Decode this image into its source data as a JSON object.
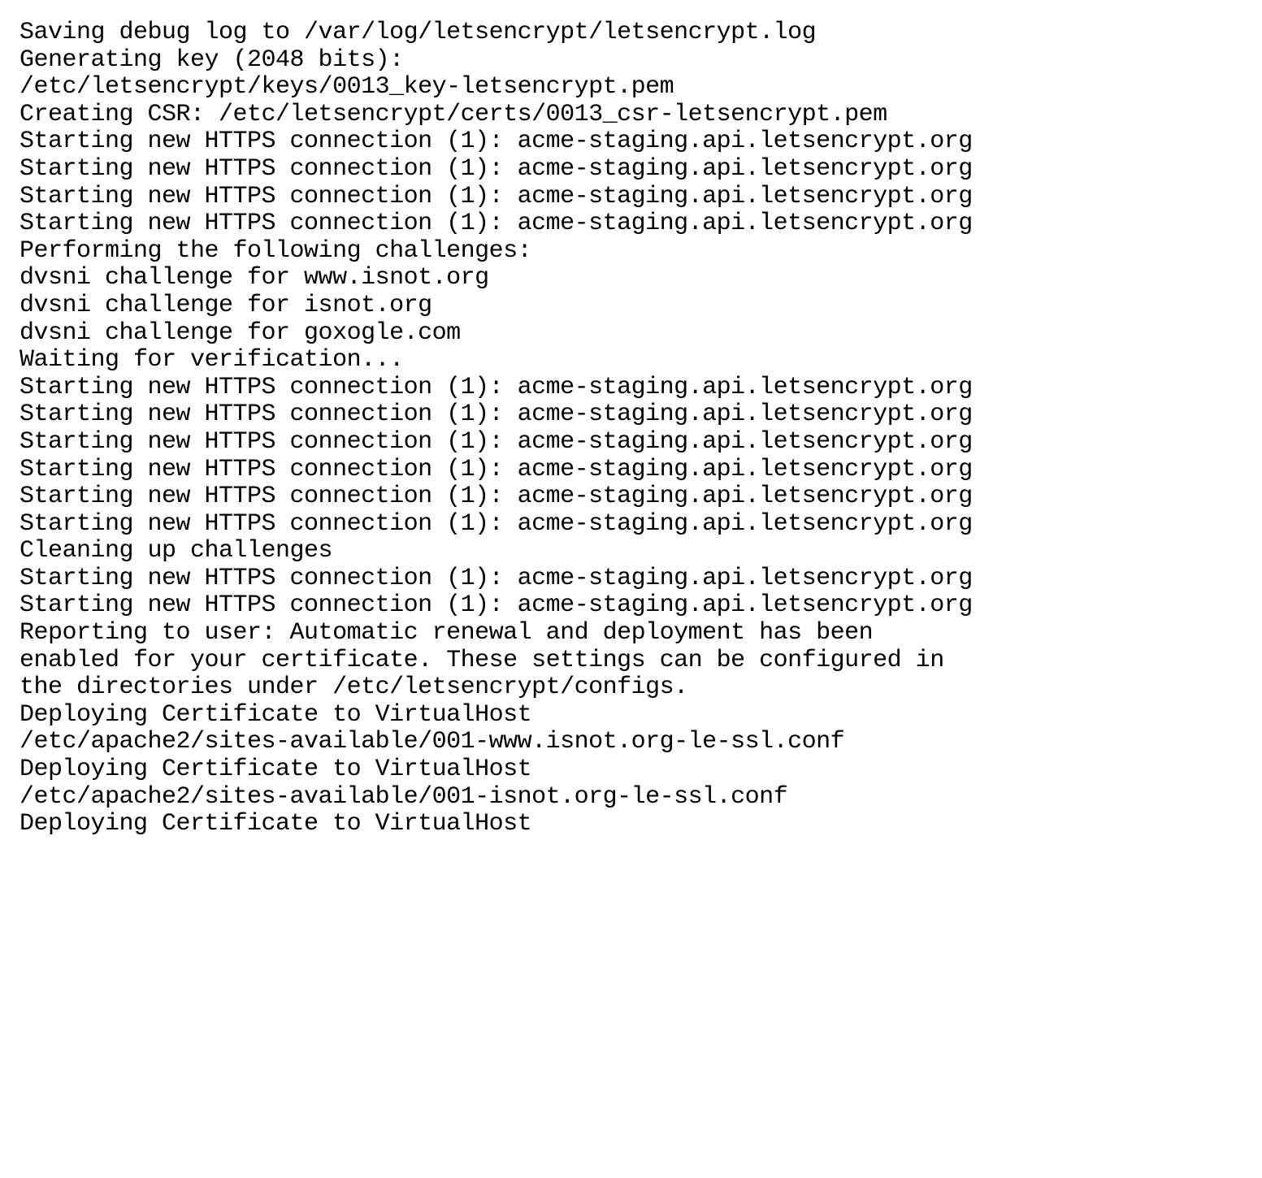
{
  "terminal": {
    "lines": [
      "Saving debug log to /var/log/letsencrypt/letsencrypt.log",
      "Generating key (2048 bits):",
      "/etc/letsencrypt/keys/0013_key-letsencrypt.pem",
      "Creating CSR: /etc/letsencrypt/certs/0013_csr-letsencrypt.pem",
      "Starting new HTTPS connection (1): acme-staging.api.letsencrypt.org",
      "Starting new HTTPS connection (1): acme-staging.api.letsencrypt.org",
      "Starting new HTTPS connection (1): acme-staging.api.letsencrypt.org",
      "Starting new HTTPS connection (1): acme-staging.api.letsencrypt.org",
      "Performing the following challenges:",
      "dvsni challenge for www.isnot.org",
      "dvsni challenge for isnot.org",
      "dvsni challenge for goxogle.com",
      "Waiting for verification...",
      "Starting new HTTPS connection (1): acme-staging.api.letsencrypt.org",
      "Starting new HTTPS connection (1): acme-staging.api.letsencrypt.org",
      "Starting new HTTPS connection (1): acme-staging.api.letsencrypt.org",
      "Starting new HTTPS connection (1): acme-staging.api.letsencrypt.org",
      "Starting new HTTPS connection (1): acme-staging.api.letsencrypt.org",
      "Starting new HTTPS connection (1): acme-staging.api.letsencrypt.org",
      "Cleaning up challenges",
      "Starting new HTTPS connection (1): acme-staging.api.letsencrypt.org",
      "Starting new HTTPS connection (1): acme-staging.api.letsencrypt.org",
      "Reporting to user: Automatic renewal and deployment has been",
      "enabled for your certificate. These settings can be configured in",
      "the directories under /etc/letsencrypt/configs.",
      "Deploying Certificate to VirtualHost",
      "/etc/apache2/sites-available/001-www.isnot.org-le-ssl.conf",
      "Deploying Certificate to VirtualHost",
      "/etc/apache2/sites-available/001-isnot.org-le-ssl.conf",
      "Deploying Certificate to VirtualHost"
    ]
  }
}
